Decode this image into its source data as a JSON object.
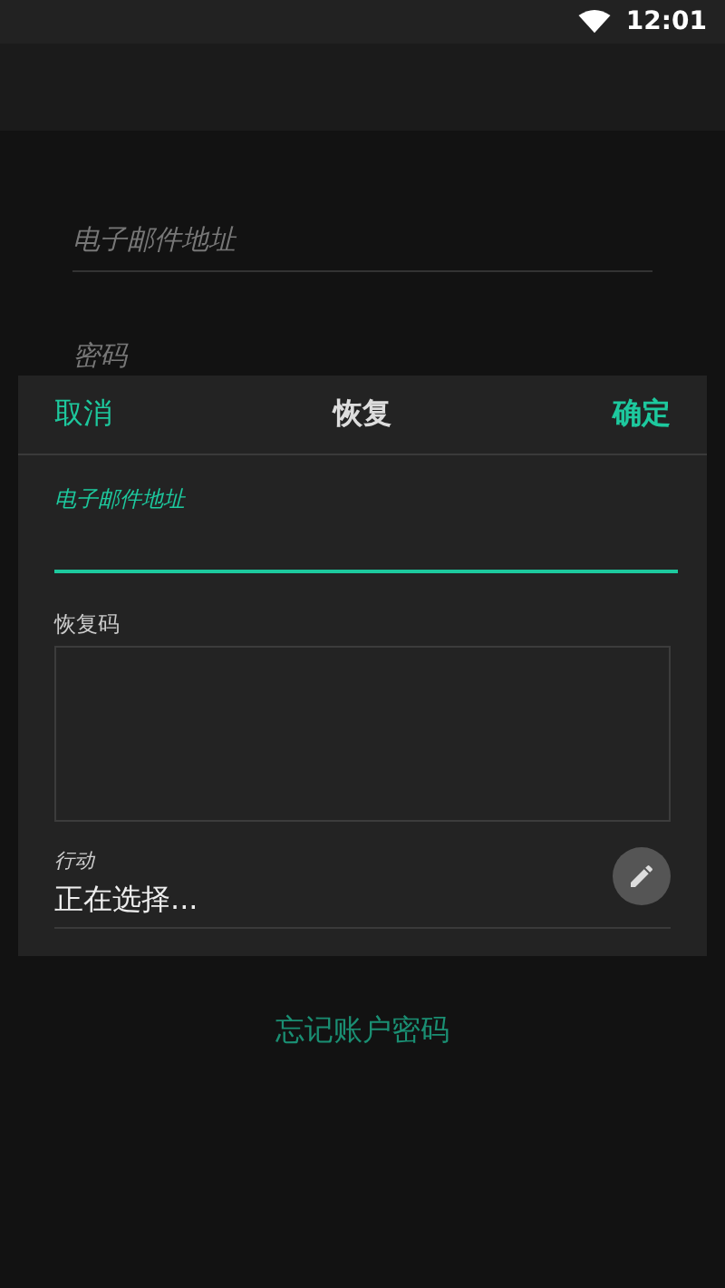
{
  "status_bar": {
    "time": "12:01"
  },
  "login_form": {
    "email": {
      "placeholder": "电子邮件地址"
    },
    "password": {
      "placeholder": "密码"
    },
    "forgot_link": "忘记账户密码"
  },
  "dialog": {
    "cancel": "取消",
    "title": "恢复",
    "confirm": "确定",
    "fields": [
      {
        "kind": "line",
        "label": "电子邮件地址",
        "focused": true
      },
      {
        "kind": "area",
        "label": "恢复码"
      },
      {
        "kind": "picker",
        "label": "行动",
        "value": "正在选择..."
      }
    ]
  }
}
